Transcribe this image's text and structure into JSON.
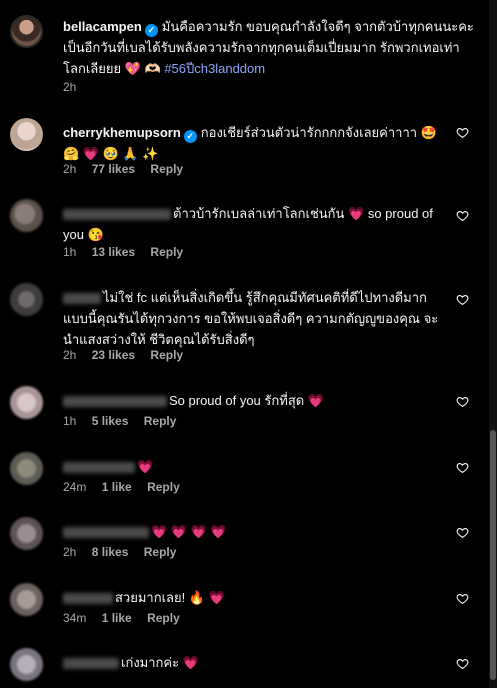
{
  "post": {
    "username": "bellacampen",
    "caption": "มันคือความรัก ขอบคุณกำลังใจดีๆ จากตัวบ้าทุกคนนะคะ เป็นอีกวันที่เบลได้รับพลังความรักจากทุกคนเต็มเปี่ยมมาก รักพวกเทอเท่าโลกเลียยย 💖 🫶🏻",
    "hashtag": "#56ปีch3landdom",
    "time": "2h"
  },
  "comments": [
    {
      "username": "cherrykhemupsorn",
      "verified": true,
      "text": "กองเชียร์ส่วนตัวน่ารักกกกจังเลยค่าาาา 🤩",
      "text2": "🤗 💗 🥹 🙏 ✨",
      "time": "2h",
      "likes": "77 likes",
      "reply": "Reply"
    },
    {
      "text": "ต้าวบ้ารักเบลล่าเท่าโลกเช่นกัน 💗 so proud of",
      "text2": "you 😘",
      "time": "1h",
      "likes": "13 likes",
      "reply": "Reply"
    },
    {
      "text": "ไม่ใช่ fc แต่เห็นสิ่งเกิดขึ้น รู้สึกคุณมีทัศนคติที่ดีไปทางดีมาก",
      "text2": "แบบนี้คุณรันได้ทุกวงการ ขอให้พบเจอสิ่งดีๆ ความกตัญญูของคุณ จะ",
      "text3": "นำแสงสว่างให้ ชีวิตคุณได้รับสิ่งดีๆ",
      "time": "2h",
      "likes": "23 likes",
      "reply": "Reply"
    },
    {
      "text": "So proud of you รักที่สุด 💗",
      "time": "1h",
      "likes": "5 likes",
      "reply": "Reply"
    },
    {
      "text": "💗",
      "time": "24m",
      "likes": "1 like",
      "reply": "Reply"
    },
    {
      "text": "💗 💗 💗 💗",
      "time": "2h",
      "likes": "8 likes",
      "reply": "Reply"
    },
    {
      "text": "สวยมากเลย! 🔥 💗",
      "time": "34m",
      "likes": "1 like",
      "reply": "Reply"
    },
    {
      "text": "เก่งมากค่ะ 💗"
    }
  ],
  "colors": {
    "accent": "#0095f6",
    "heart": "#ff3d6e",
    "muted": "#a8a8a8",
    "hashtag": "#8fa6f7"
  }
}
